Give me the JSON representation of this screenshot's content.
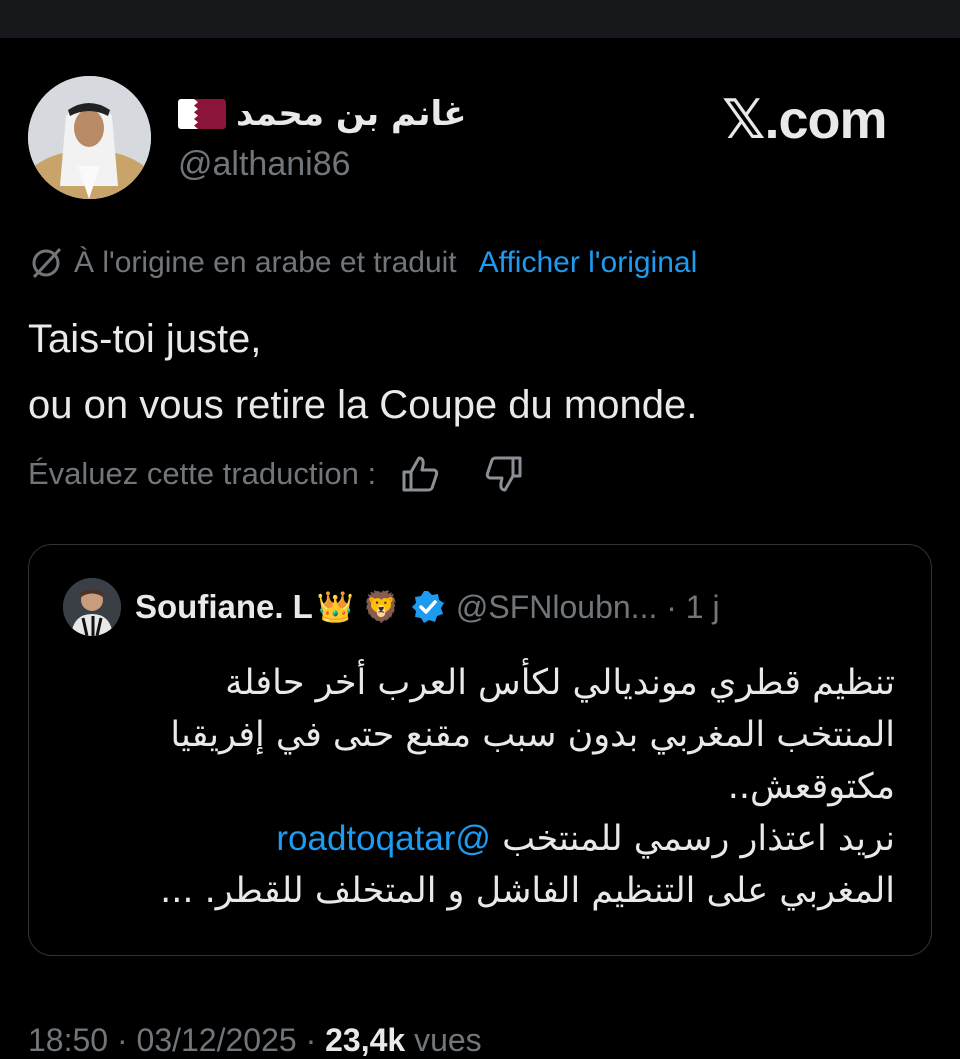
{
  "tweet": {
    "author_name": "غانم بن محمد",
    "flag_icon": "qatar-flag-icon",
    "handle": "@althani86",
    "brand": "𝕏.com",
    "translation_note": "À l'origine en arabe et traduit",
    "show_original": "Afficher l'original",
    "text_line1": "Tais-toi juste,",
    "text_line2": "ou on vous retire la Coupe du monde.",
    "rate_label": "Évaluez cette traduction :"
  },
  "quote": {
    "author_name": "Soufiane. L",
    "emojis": "👑 🦁",
    "handle": "@SFNloubn... · 1 j",
    "line1": "تنظيم قطري مونديالي لكأس العرب أخر حافلة",
    "line2": "المنتخب المغربي بدون سبب مقنع حتى في إفريقيا",
    "line3": "مكتوقعش..",
    "mention": "@roadtoqatar",
    "line4_rest": "نريد اعتذار رسمي للمنتخب",
    "line5": "المغربي على التنظيم الفاشل و المتخلف للقطر. ..."
  },
  "footer": {
    "time": "18:50 · 03/12/2025 · ",
    "views_count": "23,4k",
    "views_label": " vues"
  },
  "colors": {
    "background": "#000000",
    "text": "#e7e9ea",
    "muted": "#71767b",
    "link": "#1d9bf0",
    "border": "#2f3336"
  }
}
